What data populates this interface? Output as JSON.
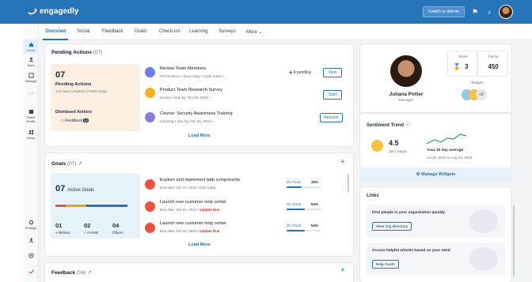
{
  "app": {
    "logo": "engagedly",
    "switch_admin": "Switch to Admin"
  },
  "rail": [
    {
      "label": "Home"
    },
    {
      "label": "Team"
    },
    {
      "label": "Manage"
    },
    {
      "label": "Talent Profile"
    },
    {
      "label": "Views"
    },
    {
      "label": "Settings"
    }
  ],
  "tabs": [
    "Overview",
    "Social",
    "Feedback",
    "Goals",
    "Check-ins",
    "Learning",
    "Surveys",
    "More"
  ],
  "pending": {
    "title": "Pending Actions",
    "count": "(07)",
    "big": "07",
    "label": "Pending Actions",
    "desc": "You have completed 3 tasks today",
    "dismissed": "Dismissed Actions",
    "feedback_label": "Feedback",
    "feedback_count": "02",
    "load_more": "Load More",
    "items": [
      {
        "title": "Review Team Members",
        "sub": "Performance • Due today • Cycle name •",
        "pending": "4 pending",
        "action": "View"
      },
      {
        "title": "Product Team Research Survey",
        "sub": "Survey • Due by: Oct 15, 2022 •",
        "action": "Start"
      },
      {
        "title": "Course: Security Awareness Training",
        "sub": "Learning • Due by: Oct 20, 2022 •",
        "action": "Resume"
      }
    ]
  },
  "goals": {
    "title": "Goals",
    "count": "(07)",
    "big": "07",
    "label": "Active Goals",
    "stats": [
      {
        "value": "01",
        "label": "Behind",
        "color": "#e4572e"
      },
      {
        "value": "02",
        "label": "At Risk",
        "color": "#f59e0b"
      },
      {
        "value": "04",
        "label": "Others",
        "color": "#2574b8"
      }
    ],
    "load_more": "Load More",
    "items": [
      {
        "title": "Explore and implement web components",
        "sub": "End date: Oct 12, 2022 • Due today",
        "badge": "",
        "status": "On Track",
        "pct": "45%",
        "progress": 0.45
      },
      {
        "title": "Launch new customer help center",
        "sub": "End date: Oct 22, 2022 •",
        "badge": "Update Due",
        "status": "On Track",
        "pct": "54%",
        "progress": 0.54
      },
      {
        "title": "Launch new customer help center",
        "sub": "End date: Oct 22, 2022 •",
        "badge": "Update Due",
        "status": "On Track",
        "pct": "54%",
        "progress": 0.54
      }
    ]
  },
  "feedback": {
    "title": "Feedback",
    "count": "(04)"
  },
  "profile": {
    "name": "Juliana Potter",
    "role": "Manager",
    "rank_label": "Rank",
    "rank": "3",
    "points_label": "Points",
    "points": "450",
    "badges_label": "Badges",
    "badges_more": "+2"
  },
  "sentiment": {
    "title": "Sentiment Trend",
    "score": "4.5",
    "mood": "Very Happy",
    "avg": "Your 30 day average",
    "range": "Jul 25, 2022 to Aug 23, 2022"
  },
  "manage_widgets": "Manage Widgets",
  "links": {
    "title": "Links",
    "items": [
      {
        "text": "Find people in your organization quickly",
        "button": "View Org Directory"
      },
      {
        "text": "Access helpful articles based on your need",
        "button": "Help Guide"
      }
    ]
  },
  "colors": {
    "brand": "#2574b8",
    "accent": "#e4572e"
  }
}
